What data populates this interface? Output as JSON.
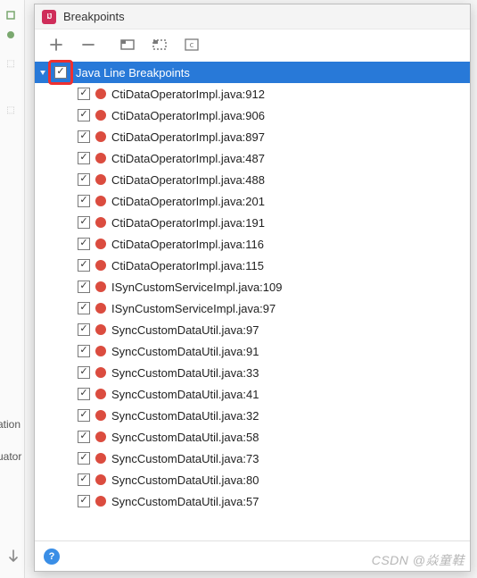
{
  "window": {
    "title": "Breakpoints"
  },
  "toolbar": {
    "add_tip": "Add",
    "remove_tip": "Remove"
  },
  "root": {
    "label": "Java Line Breakpoints"
  },
  "breakpoints": [
    {
      "label": "CtiDataOperatorImpl.java:912"
    },
    {
      "label": "CtiDataOperatorImpl.java:906"
    },
    {
      "label": "CtiDataOperatorImpl.java:897"
    },
    {
      "label": "CtiDataOperatorImpl.java:487"
    },
    {
      "label": "CtiDataOperatorImpl.java:488"
    },
    {
      "label": "CtiDataOperatorImpl.java:201"
    },
    {
      "label": "CtiDataOperatorImpl.java:191"
    },
    {
      "label": "CtiDataOperatorImpl.java:116"
    },
    {
      "label": "CtiDataOperatorImpl.java:115"
    },
    {
      "label": "ISynCustomServiceImpl.java:109"
    },
    {
      "label": "ISynCustomServiceImpl.java:97"
    },
    {
      "label": "SyncCustomDataUtil.java:97"
    },
    {
      "label": "SyncCustomDataUtil.java:91"
    },
    {
      "label": "SyncCustomDataUtil.java:33"
    },
    {
      "label": "SyncCustomDataUtil.java:41"
    },
    {
      "label": "SyncCustomDataUtil.java:32"
    },
    {
      "label": "SyncCustomDataUtil.java:58"
    },
    {
      "label": "SyncCustomDataUtil.java:73"
    },
    {
      "label": "SyncCustomDataUtil.java:80"
    },
    {
      "label": "SyncCustomDataUtil.java:57"
    }
  ],
  "side": {
    "label_1": "ation",
    "label_2": "uator"
  },
  "watermark": "CSDN @焱童鞋",
  "help": "?"
}
